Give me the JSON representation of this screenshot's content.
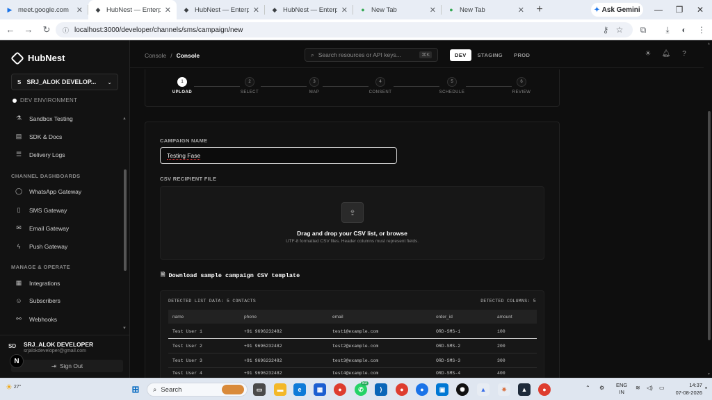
{
  "browser": {
    "tabs": [
      {
        "title": "meet.google.com",
        "icon": "meet-icon"
      },
      {
        "title": "HubNest — Enterprise",
        "icon": "hubnest-icon",
        "active": true
      },
      {
        "title": "HubNest — Enterprise",
        "icon": "hubnest-icon"
      },
      {
        "title": "HubNest — Enterprise",
        "icon": "hubnest-icon"
      },
      {
        "title": "New Tab",
        "icon": "chrome-icon"
      },
      {
        "title": "New Tab",
        "icon": "chrome-icon"
      }
    ],
    "gemini_label": "Ask Gemini",
    "url": "localhost:3000/developer/channels/sms/campaign/new"
  },
  "sidebar": {
    "brand": "HubNest",
    "workspace": {
      "badge": "S",
      "name": "SRJ_ALOK DEVELOP..."
    },
    "environment": "DEV ENVIRONMENT",
    "items_top": [
      {
        "label": "Sandbox Testing",
        "icon": "flask-icon"
      },
      {
        "label": "SDK & Docs",
        "icon": "book-icon"
      },
      {
        "label": "Delivery Logs",
        "icon": "list-icon"
      }
    ],
    "section_channels": "CHANNEL DASHBOARDS",
    "channels": [
      {
        "label": "WhatsApp Gateway",
        "icon": "chat-icon"
      },
      {
        "label": "SMS Gateway",
        "icon": "phone-icon"
      },
      {
        "label": "Email Gateway",
        "icon": "mail-icon"
      },
      {
        "label": "Push Gateway",
        "icon": "bolt-icon"
      }
    ],
    "section_manage": "MANAGE & OPERATE",
    "manage": [
      {
        "label": "Integrations",
        "icon": "grid-icon"
      },
      {
        "label": "Subscribers",
        "icon": "users-icon"
      },
      {
        "label": "Webhooks",
        "icon": "webhook-icon"
      }
    ],
    "user": {
      "initials": "SD",
      "name": "SRJ_ALOK DEVELOPER",
      "email": "srjalokdeveloper@gmail.com"
    },
    "signout": "Sign Out"
  },
  "topbar": {
    "crumb_root": "Console",
    "crumb_sep": "/",
    "crumb_current": "Console",
    "search_placeholder": "Search resources or API keys...",
    "search_shortcut": "⌘K",
    "envs": [
      "DEV",
      "STAGING",
      "PROD"
    ],
    "active_env": "DEV"
  },
  "stepper": {
    "steps": [
      {
        "num": "1",
        "label": "UPLOAD"
      },
      {
        "num": "2",
        "label": "SELECT"
      },
      {
        "num": "3",
        "label": "MAP"
      },
      {
        "num": "4",
        "label": "CONSENT"
      },
      {
        "num": "5",
        "label": "SCHEDULE"
      },
      {
        "num": "6",
        "label": "REVIEW"
      }
    ],
    "current": 1
  },
  "form": {
    "campaign_label": "CAMPAIGN NAME",
    "campaign_value": "Testing Fase",
    "csv_label": "CSV RECIPIENT FILE",
    "drop_title": "Drag and drop your CSV list, or browse",
    "drop_sub": "UTF-8 formatted CSV files. Header columns must represent fields.",
    "download_label": "Download sample campaign CSV template"
  },
  "table": {
    "detected": "DETECTED LIST DATA: 5 CONTACTS",
    "columns_count": "DETECTED COLUMNS: 5",
    "headers": [
      "name",
      "phone",
      "email",
      "order_id",
      "amount"
    ],
    "rows": [
      [
        "Test User 1",
        "+91 9696232482",
        "test1@example.com",
        "ORD-SMS-1",
        "100"
      ],
      [
        "Test User 2",
        "+91 9696232482",
        "test2@example.com",
        "ORD-SMS-2",
        "200"
      ],
      [
        "Test User 3",
        "+91 9696232482",
        "test3@example.com",
        "ORD-SMS-3",
        "300"
      ],
      [
        "Test User 4",
        "+91 9696232482",
        "test4@example.com",
        "ORD-SMS-4",
        "400"
      ]
    ]
  },
  "taskbar": {
    "weather": "27°",
    "search": "Search",
    "lang1": "ENG",
    "lang2": "IN",
    "time": "14:37",
    "date": "07-08-2026",
    "whatsapp_badge": "83"
  }
}
